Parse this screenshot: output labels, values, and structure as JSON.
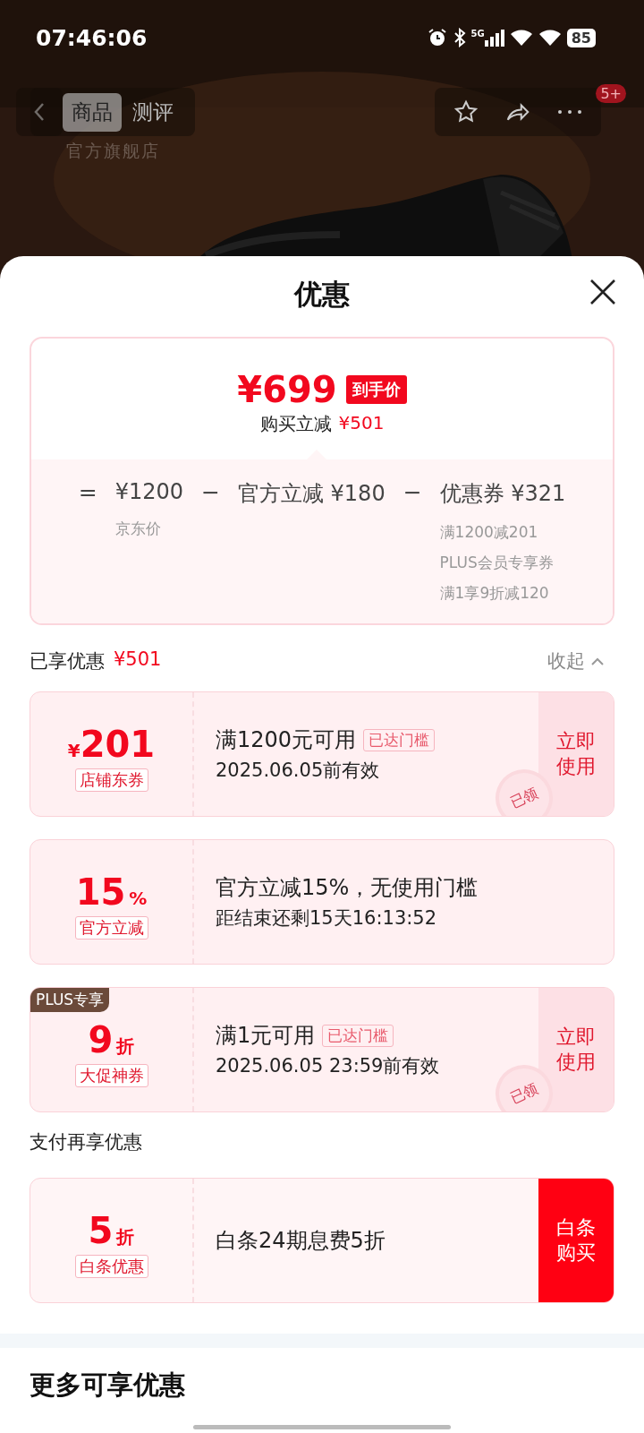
{
  "status_bar": {
    "time": "07:46:06",
    "network": "5G",
    "battery": "85"
  },
  "header": {
    "store_label": "官方旗舰店",
    "tabs": [
      {
        "label": "商品",
        "selected": true
      },
      {
        "label": "测评",
        "selected": false
      }
    ],
    "badge": "5+"
  },
  "sheet": {
    "title": "优惠",
    "summary": {
      "price": "¥699",
      "price_tag": "到手价",
      "saving_label": "购买立减",
      "saving": "¥501",
      "formula": [
        {
          "kind": "op",
          "text": "="
        },
        {
          "kind": "term",
          "text": "¥1200",
          "notes": [
            "京东价"
          ]
        },
        {
          "kind": "op",
          "text": "−"
        },
        {
          "kind": "term",
          "text": "官方立减 ¥180"
        },
        {
          "kind": "op",
          "text": "−"
        },
        {
          "kind": "term",
          "text": "优惠券 ¥321",
          "notes": [
            "满1200减201",
            "PLUS会员专享券",
            "满1享9折减120"
          ]
        }
      ]
    },
    "applied": {
      "title": "已享优惠",
      "amount": "¥501",
      "toggle": "收起",
      "expanded": true
    },
    "coupons": [
      {
        "prefix": "¥",
        "value": "201",
        "tag": "店铺东券",
        "title": "满1200元可用",
        "badge": "已达门槛",
        "validity": "2025.06.05前有效",
        "action": {
          "label": "立即使用",
          "solid": false
        },
        "stamp": "已领"
      },
      {
        "value": "15",
        "suffix": "%",
        "tag": "官方立减",
        "title": "官方立减15%，无使用门槛",
        "validity": "距结束还剩15天16:13:52"
      },
      {
        "corner": "PLUS专享",
        "value": "9",
        "suffix": "折",
        "tag": "大促神券",
        "title": "满1元可用",
        "badge": "已达门槛",
        "validity": "2025.06.05 23:59前有效",
        "action": {
          "label": "立即使用",
          "solid": false
        },
        "stamp": "已领"
      }
    ],
    "pay_title": "支付再享优惠",
    "pay_coupons": [
      {
        "value": "5",
        "suffix": "折",
        "tag": "白条优惠",
        "title": "白条24期息费5折",
        "action": {
          "label": "白条购买",
          "solid": true
        }
      }
    ],
    "more_title": "更多可享优惠"
  }
}
